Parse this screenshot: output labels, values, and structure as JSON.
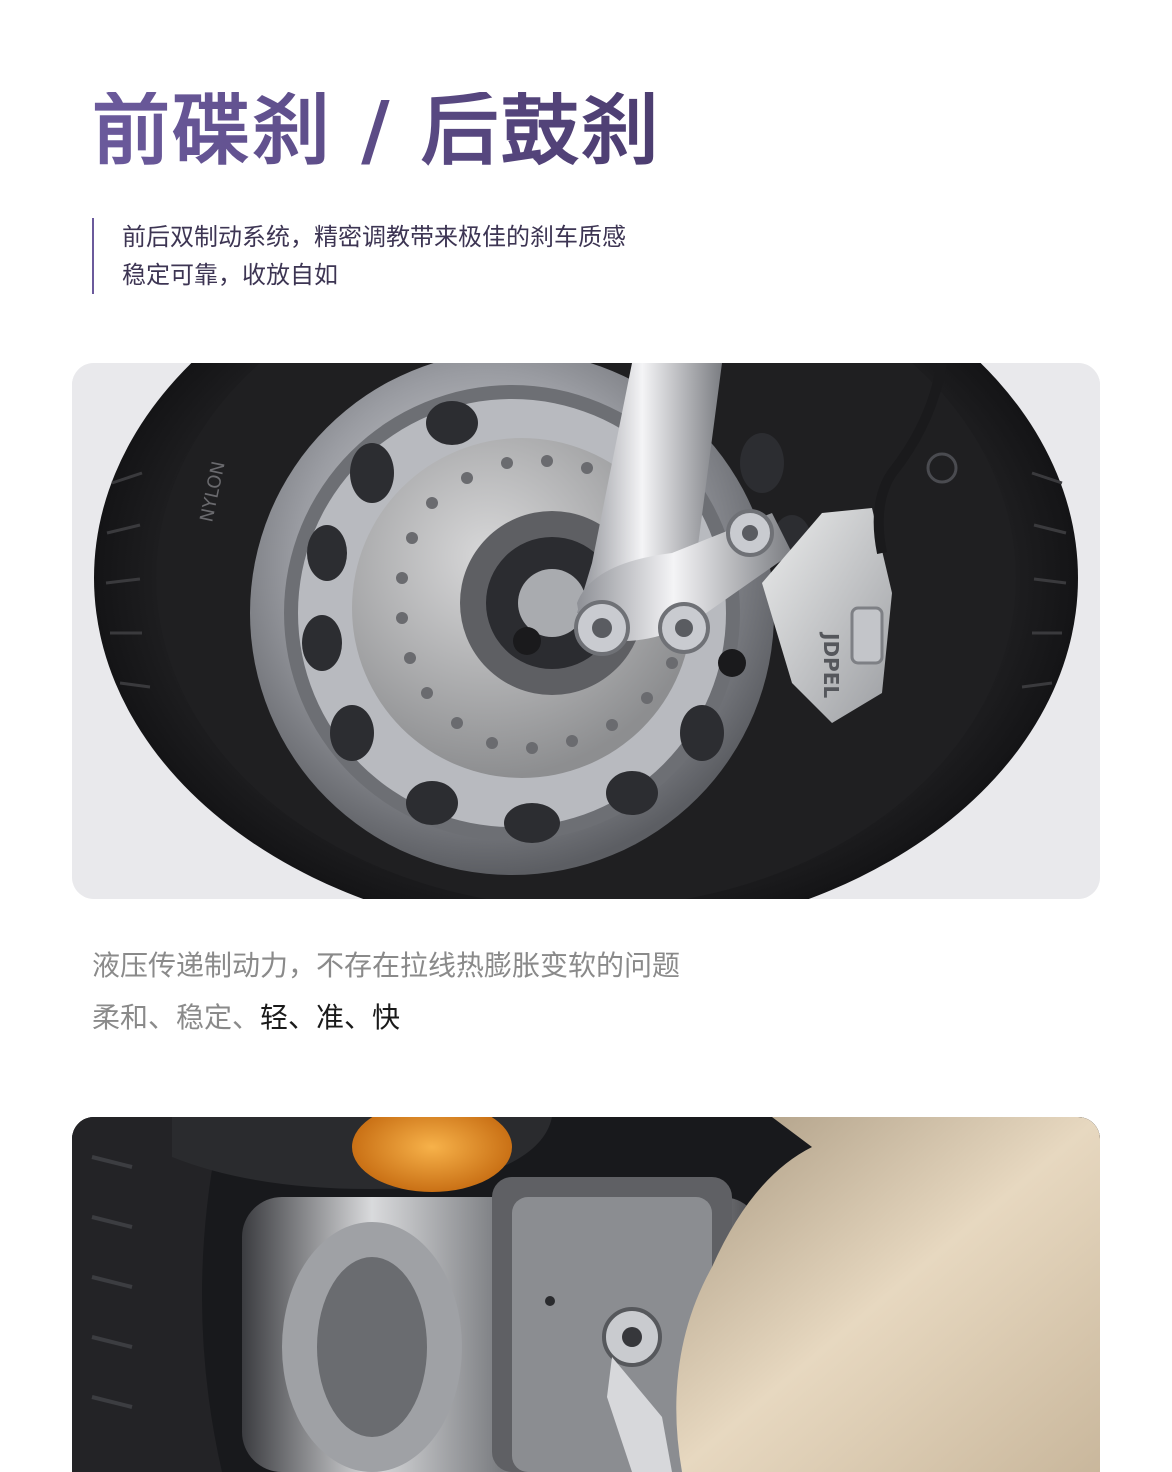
{
  "header": {
    "title": "前碟刹 / 后鼓刹",
    "subtitle_line1": "前后双制动系统，精密调教带来极佳的刹车质感",
    "subtitle_line2": "稳定可靠，收放自如"
  },
  "front_photo": {
    "tire_text": "NYLON",
    "caliper_text": "JDPEL"
  },
  "description": {
    "line1": "液压传递制动力，不存在拉线热膨胀变软的问题",
    "line2_gray": "柔和、稳定、",
    "line2_bold": "轻、准、快"
  },
  "colors": {
    "title_accent": "#5b4c85",
    "gray_text": "#8a8a8a",
    "strong_text": "#1a1a1a"
  }
}
